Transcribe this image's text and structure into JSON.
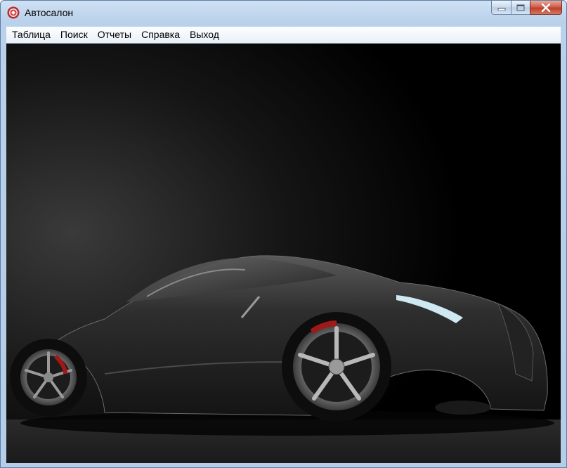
{
  "window": {
    "title": "Автосалон",
    "icon": "app-logo-icon",
    "controls": [
      "minimize-icon",
      "maximize-icon",
      "close-icon"
    ]
  },
  "menu": {
    "items": [
      {
        "label": "Таблица"
      },
      {
        "label": "Поиск"
      },
      {
        "label": "Отчеты"
      },
      {
        "label": "Справка"
      },
      {
        "label": "Выход"
      }
    ]
  },
  "content": {
    "image": "black-sports-car-photo"
  },
  "colors": {
    "title_bar": "#b9d1ea",
    "close_button": "#c9503b",
    "content_background": "#000000"
  }
}
